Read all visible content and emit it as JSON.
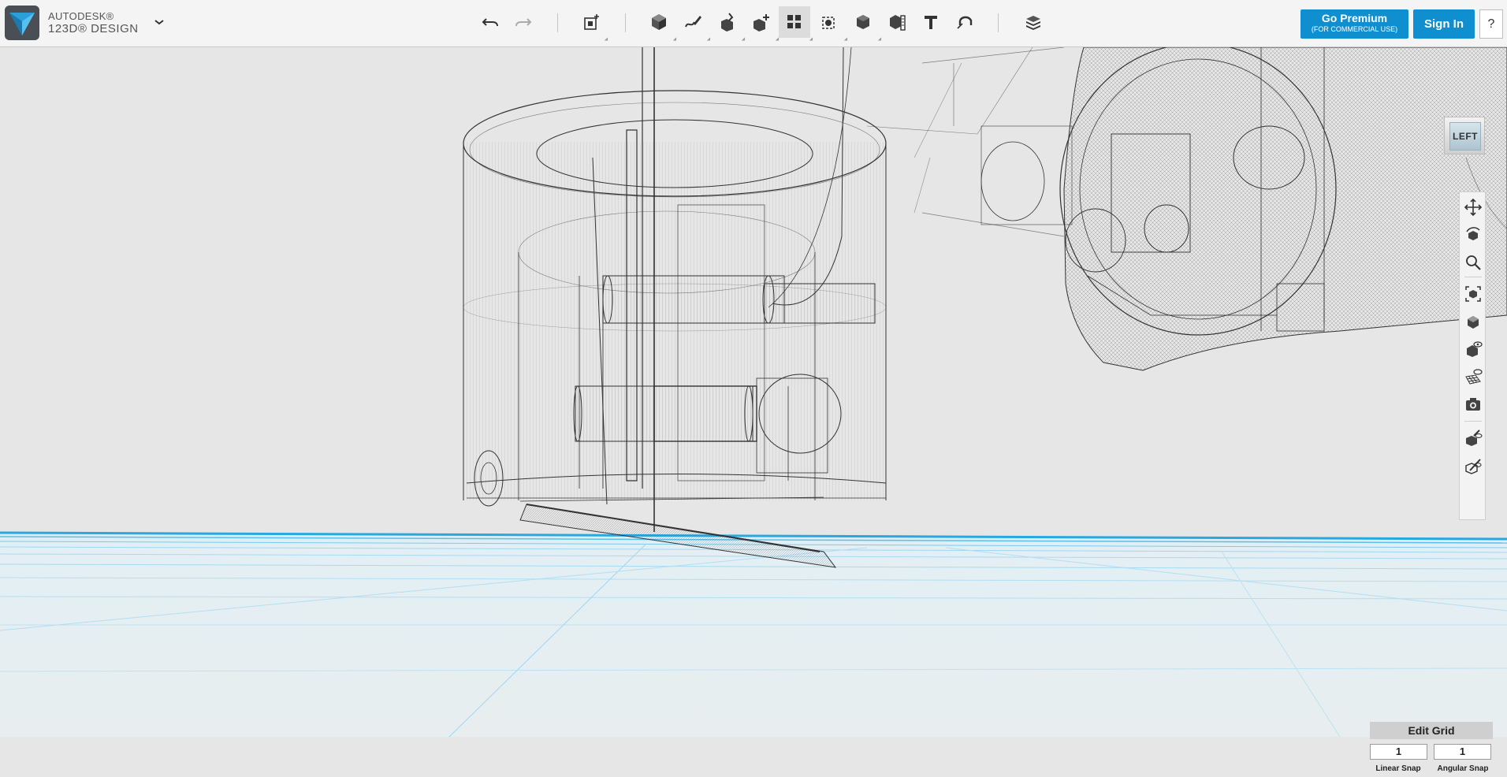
{
  "app": {
    "brand_line1": "AUTODESK®",
    "brand_line2": "123D® DESIGN"
  },
  "toolbar": {
    "icons": [
      "undo-icon",
      "redo-icon",
      "add-object-icon",
      "primitives-icon",
      "sketch-icon",
      "construct-icon",
      "modify-icon",
      "pattern-icon",
      "grouping-icon",
      "combine-icon",
      "measure-icon",
      "text-icon",
      "snap-icon",
      "material-icon"
    ]
  },
  "header": {
    "premium_label": "Go Premium",
    "premium_sub": "(FOR COMMERCIAL USE)",
    "signin_label": "Sign In",
    "help_label": "?"
  },
  "viewcube": {
    "face_label": "LEFT"
  },
  "nav": {
    "tools": [
      "pan-icon",
      "orbit-icon",
      "zoom-icon",
      "fit-icon",
      "views-icon",
      "visibility-icon",
      "grid-visibility-icon",
      "screenshot-icon",
      "material-visibility-icon",
      "outline-visibility-icon"
    ]
  },
  "grid": {
    "edit_label": "Edit Grid",
    "linear_value": "1",
    "angular_value": "1",
    "linear_label": "Linear Snap",
    "angular_label": "Angular Snap"
  },
  "colors": {
    "accent": "#0f8ed0",
    "floor_line": "#29a8e0",
    "wire": "#333333"
  }
}
